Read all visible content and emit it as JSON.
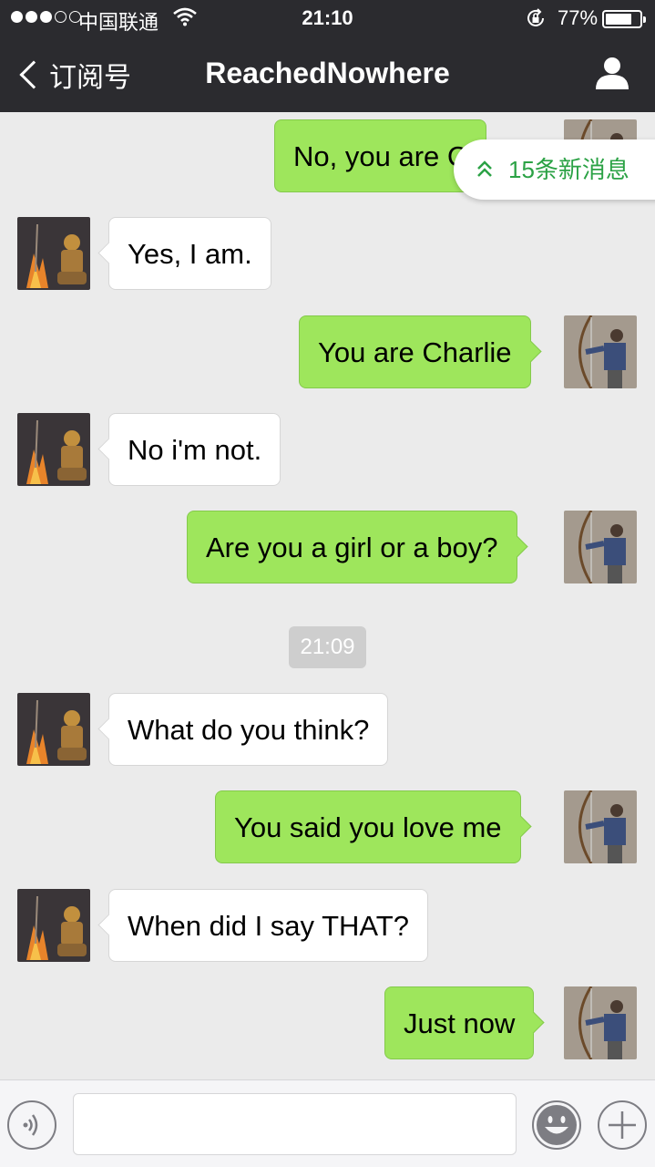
{
  "status_bar": {
    "carrier": "中国联通",
    "time": "21:10",
    "battery": "77%",
    "battery_level": 0.77,
    "signal_bars_filled": 3,
    "signal_bars_total": 5
  },
  "nav": {
    "back_label": "订阅号",
    "title": "ReachedNowhere"
  },
  "new_messages_banner": "15条新消息",
  "messages": [
    {
      "side": "out",
      "text": "No, you are C"
    },
    {
      "side": "in",
      "text": "Yes, I am."
    },
    {
      "side": "out",
      "text": "You are Charlie"
    },
    {
      "side": "in",
      "text": "No i'm not."
    },
    {
      "side": "out",
      "text": "Are you a girl or a boy?"
    },
    {
      "side": "in",
      "text": "What do you think?"
    },
    {
      "side": "out",
      "text": "You said you love me"
    },
    {
      "side": "in",
      "text": "When did I say THAT?"
    },
    {
      "side": "out",
      "text": "Just now"
    }
  ],
  "timestamp": "21:09",
  "colors": {
    "nav_background": "#2b2b2f",
    "chat_background": "#ebebeb",
    "outgoing_bubble": "#9ee65c",
    "incoming_bubble": "#ffffff",
    "banner_text": "#2ba245"
  },
  "icons": {
    "voice": "voice-icon",
    "emoji": "emoji-icon",
    "more": "plus-icon",
    "profile": "person-icon",
    "back": "chevron-left-icon",
    "banner": "double-chevron-up-icon"
  }
}
